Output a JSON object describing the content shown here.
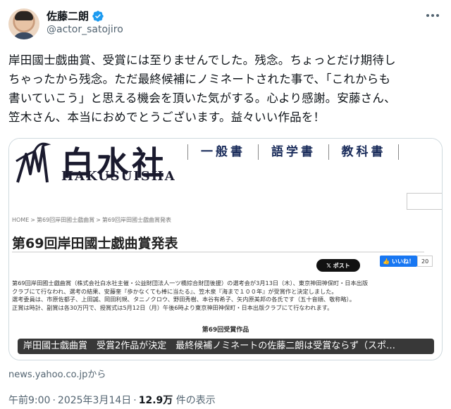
{
  "author": {
    "display_name": "佐藤二朗",
    "handle": "@actor_satojiro"
  },
  "tweet": {
    "lines": [
      "岸田國士戯曲賞、受賞には至りませんでした。残念。ちょっとだけ期待し",
      "ちゃったから残念。ただ最終候補にノミネートされた事で、「これからも",
      "書いていこう」と思える機会を頂いた気がする。心より感謝。安藤さん、",
      "笠木さん、本当におめでとうございます。益々いい作品を！"
    ]
  },
  "card": {
    "logo_text": "白水社",
    "logo_sub": "HAKUSUISHA",
    "nav": [
      "一般書",
      "語学書",
      "教科書"
    ],
    "breadcrumb": [
      "HOME",
      "第69回岸田國士戯曲賞",
      "第69回岸田國士戯曲賞発表"
    ],
    "page_heading": "第69回岸田國士戯曲賞発表",
    "x_post_label": "ポスト",
    "fb_like_label": "いいね！",
    "fb_count": "20",
    "body_lines": [
      "第69回岸田國士戯曲賞（株式会社白水社主催・公益財団法人一ツ橋綜合財団後援）の選考会が3月13日（木）、東京神田神保町・日本出版",
      "クラブにて行なわれ、選考の結果、安藤奎『歩かなくても棒に当たる』、笠木泉『海まで１００年』が受賞作と決定しました。",
      "選考委員は、市原佐都子、上田誠、岡田利規、タニノクロウ、野田秀樹、本谷有希子、矢内原美邦の各氏です（五十音順、敬称略）。",
      "正賞は時計、副賞は各30万円で、授賞式は5月12日（月）午後6時より東京神田神保町・日本出版クラブにて行なわれます。"
    ],
    "section_title": "第69回受賞作品",
    "headline": "岸田國士戯曲賞　受賞2作品が決定　最終候補ノミネートの佐藤二朗は受賞ならず（スポ…"
  },
  "source": "news.yahoo.co.jpから",
  "meta": {
    "time": "午前9:00",
    "date": "2025年3月14日",
    "views_count": "12.9万",
    "views_label": "件の表示"
  },
  "colors": {
    "verified": "#1d9bf0",
    "text": "#0f1419",
    "secondary": "#536471",
    "fb_blue": "#1877f2"
  }
}
